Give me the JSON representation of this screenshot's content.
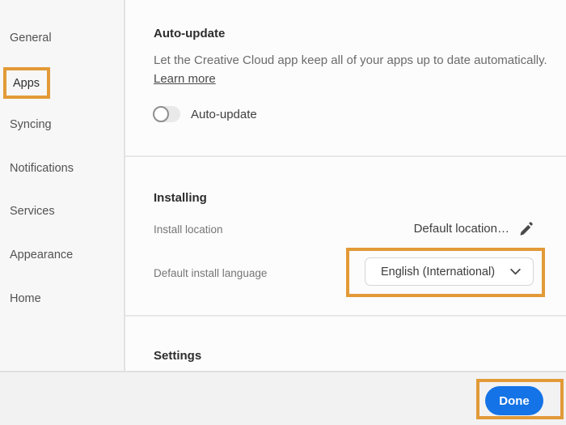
{
  "sidebar": {
    "selected": "Apps",
    "items": [
      {
        "label": "General"
      },
      {
        "label": "Apps"
      },
      {
        "label": "Syncing"
      },
      {
        "label": "Notifications"
      },
      {
        "label": "Services"
      },
      {
        "label": "Appearance"
      },
      {
        "label": "Home"
      }
    ]
  },
  "auto_update_section": {
    "title": "Auto-update",
    "description": "Let the Creative Cloud app keep all of your apps up to date automatically.",
    "learn_more_label": "Learn more",
    "toggle_label": "Auto-update",
    "toggle_state": "off"
  },
  "installing_section": {
    "title": "Installing",
    "install_location_label": "Install location",
    "install_location_value": "Default location…",
    "language_label": "Default install language",
    "language_value": "English (International)"
  },
  "settings_section": {
    "title": "Settings"
  },
  "footer": {
    "done_label": "Done"
  },
  "annotations": {
    "highlight_color": "#e29a38",
    "highlighted_elements": [
      "Apps sidebar item",
      "Default install language dropdown",
      "Done button"
    ]
  },
  "colors": {
    "accent_blue": "#1473e6",
    "highlight_orange": "#e29a38",
    "sidebar_bg": "#f7f7f7",
    "footer_bg": "#f2f2f2"
  }
}
